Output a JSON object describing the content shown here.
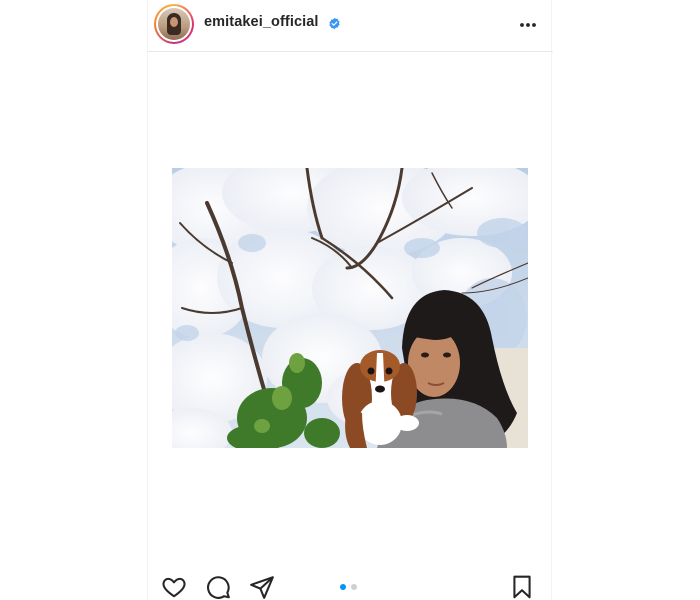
{
  "post": {
    "username": "emitakei_official",
    "verified": true,
    "avatar_icon": "profile-photo",
    "more_icon": "more-options-icon"
  },
  "photo": {
    "description_icon": "photo-cherry-blossom-woman-dog"
  },
  "carousel": {
    "count": 2,
    "active_index": 0
  },
  "actions": {
    "like_icon": "heart-icon",
    "comment_icon": "comment-icon",
    "share_icon": "send-icon",
    "save_icon": "bookmark-icon"
  },
  "colors": {
    "accent": "#0095f6",
    "verified_blue": "#3897f0",
    "text": "#262626",
    "inactive_dot": "#cfcfcf"
  }
}
